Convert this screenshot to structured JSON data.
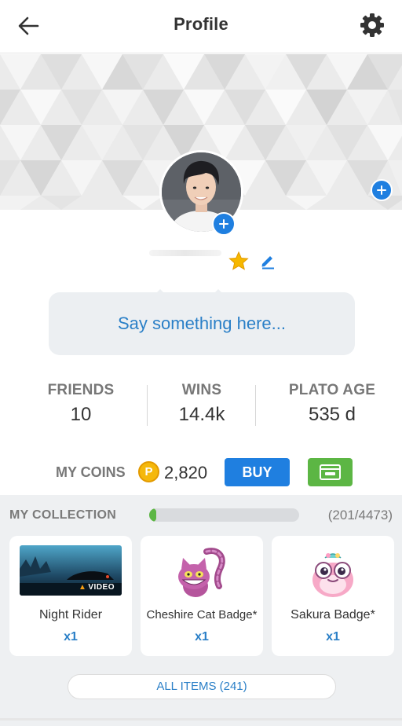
{
  "header": {
    "title": "Profile",
    "back_icon": "arrow-left-icon",
    "settings_icon": "gear-icon"
  },
  "profile": {
    "star_icon": "star-icon",
    "edit_icon": "pencil-icon",
    "bio_placeholder": "Say something here..."
  },
  "stats": [
    {
      "label": "FRIENDS",
      "value": "10"
    },
    {
      "label": "WINS",
      "value": "14.4k"
    },
    {
      "label": "PLATO AGE",
      "value": "535 d"
    }
  ],
  "coins": {
    "label": "MY COINS",
    "coin_symbol": "P",
    "amount": "2,820",
    "buy_label": "BUY",
    "wallet_icon": "wallet-icon"
  },
  "collection": {
    "label": "MY COLLECTION",
    "count": "(201/4473)",
    "progress_fraction": 0.045,
    "items": [
      {
        "name": "Night Rider",
        "qty": "x1",
        "badge": "VIDEO"
      },
      {
        "name": "Cheshire Cat Badge*",
        "qty": "x1"
      },
      {
        "name": "Sakura Badge*",
        "qty": "x1"
      }
    ],
    "all_items_label": "ALL ITEMS (241)"
  },
  "colors": {
    "accent_blue": "#1f7fe0",
    "link_blue": "#2a7fc7",
    "green": "#5cb644",
    "coin_gold": "#f5b80b"
  }
}
